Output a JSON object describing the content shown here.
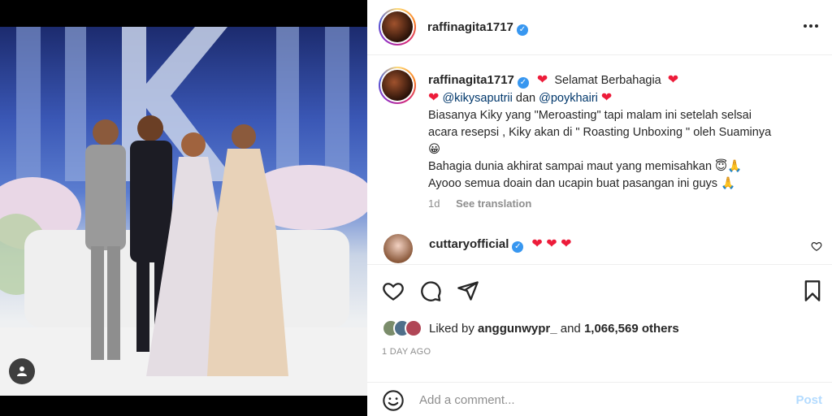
{
  "post": {
    "username": "raffinagita1717",
    "more_icon": "more-horizontal-icon"
  },
  "caption": {
    "username": "raffinagita1717",
    "line1_text": "Selamat Berbahagia",
    "mention1": "@kikysaputrii",
    "and_word": "dan",
    "mention2": "@poykhairi",
    "line3": "Biasanya Kiky yang \"Meroasting\" tapi malam ini setelah selsai",
    "line4": "acara resepsi , Kiky akan di \" Roasting Unboxing \" oleh Suaminya",
    "line5_emoji": "😀",
    "line6": "Bahagia dunia akhirat sampai maut yang memisahkan",
    "line6_emoji": "😇🙏",
    "line7": "Ayooo semua doain dan ucapin buat pasangan ini guys",
    "line7_emoji": "🙏",
    "time": "1d",
    "see_translation": "See translation"
  },
  "comment": {
    "username": "cuttaryofficial",
    "hearts": "❤ ❤ ❤"
  },
  "likes": {
    "prefix": "Liked by",
    "user": "anggunwypr_",
    "and": "and",
    "count": "1,066,569 others"
  },
  "date": "1 DAY AGO",
  "add_comment": {
    "placeholder": "Add a comment...",
    "post_label": "Post"
  },
  "colors": {
    "heart": "#ed1c3a",
    "verified": "#3897f0",
    "post_disabled": "#b3dbff"
  }
}
